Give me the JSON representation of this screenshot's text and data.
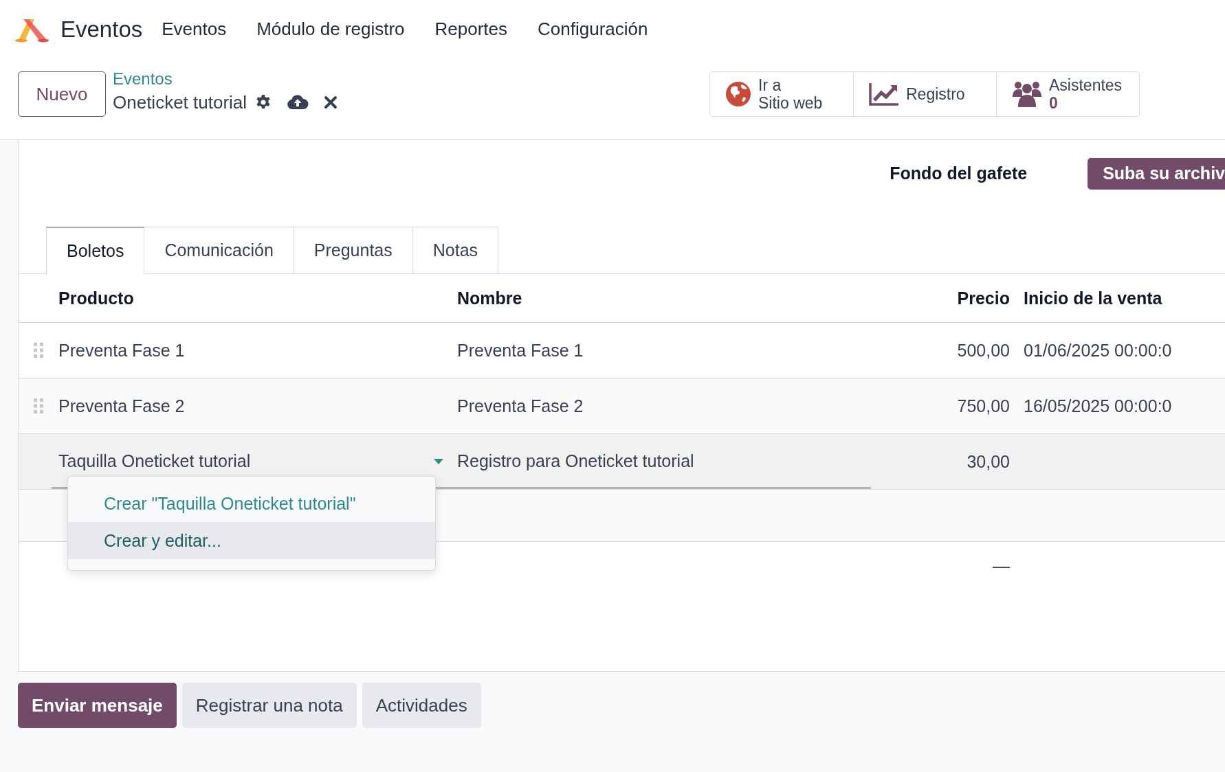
{
  "app": {
    "name": "Eventos"
  },
  "menu": [
    "Eventos",
    "Módulo de registro",
    "Reportes",
    "Configuración"
  ],
  "control_panel": {
    "new_button": "Nuevo",
    "breadcrumb": "Eventos",
    "record_title": "Oneticket tutorial"
  },
  "stat_buttons": [
    {
      "kind": "website",
      "lines": [
        "Ir a",
        "Sitio web"
      ]
    },
    {
      "kind": "registration",
      "lines": [
        "Registro"
      ]
    },
    {
      "kind": "attendees",
      "lines": [
        "Asistentes"
      ],
      "value": "0"
    }
  ],
  "badge_background": {
    "label": "Fondo del gafete",
    "upload_button": "Suba su archiv"
  },
  "tabs": [
    {
      "label": "Boletos",
      "selected": true
    },
    {
      "label": "Comunicación",
      "selected": false
    },
    {
      "label": "Preguntas",
      "selected": false
    },
    {
      "label": "Notas",
      "selected": false
    }
  ],
  "table": {
    "columns": [
      "Producto",
      "Nombre",
      "Precio",
      "Inicio de la venta"
    ],
    "rows": [
      {
        "editing": false,
        "cells": [
          "Preventa Fase 1",
          "Preventa Fase 1",
          "500,00",
          "01/06/2025 00:00:0"
        ]
      },
      {
        "editing": false,
        "cells": [
          "Preventa Fase 2",
          "Preventa Fase 2",
          "750,00",
          "16/05/2025 00:00:0"
        ]
      },
      {
        "editing": true,
        "cells": [
          "Taquilla Oneticket tutorial",
          "Registro para Oneticket tutorial",
          "30,00"
        ]
      }
    ],
    "total": "—"
  },
  "dropdown": {
    "items": [
      {
        "label": "Crear \"Taquilla Oneticket tutorial\"",
        "selected": false
      },
      {
        "label": "Crear y editar...",
        "selected": true
      }
    ]
  },
  "chatter": [
    {
      "label": "Enviar mensaje",
      "primary": true
    },
    {
      "label": "Registrar una nota",
      "primary": false
    },
    {
      "label": "Actividades",
      "primary": false
    }
  ]
}
